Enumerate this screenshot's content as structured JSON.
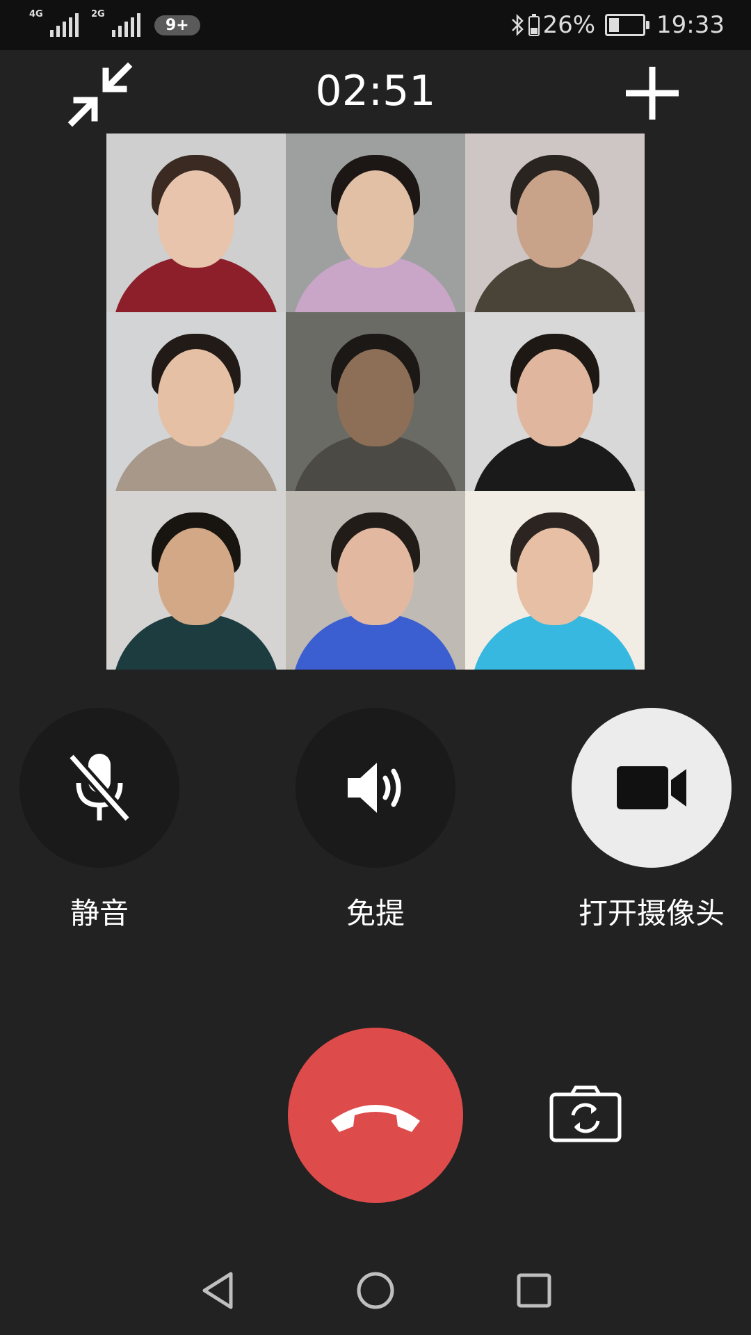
{
  "status_bar": {
    "signal1_label": "4G",
    "signal2_label": "2G",
    "notification_badge": "9+",
    "battery_percent": "26%",
    "time": "19:33"
  },
  "call": {
    "timer": "02:51"
  },
  "controls": {
    "mute_label": "静音",
    "speaker_label": "免提",
    "camera_label": "打开摄像头"
  },
  "icons": {
    "minimize": "minimize-icon",
    "add": "plus-icon",
    "mute": "mic-off-icon",
    "speaker": "speaker-icon",
    "camera": "video-camera-icon",
    "hangup": "phone-hangup-icon",
    "flip": "camera-flip-icon",
    "back": "back-triangle-icon",
    "home": "home-circle-icon",
    "recents": "recents-square-icon"
  },
  "colors": {
    "background": "#222222",
    "status_bar": "#101010",
    "hangup": "#de4b4b",
    "control_dark": "#1a1a1a",
    "control_light": "#ececec"
  },
  "participants": [
    {
      "bg": "#cfcfcf",
      "skin": "#e8c4ac",
      "hair": "#3a2a22",
      "shirt": "#8c1f2a"
    },
    {
      "bg": "#9ea0a0",
      "skin": "#e2c0a6",
      "hair": "#1c1714",
      "shirt": "#c9a5c8"
    },
    {
      "bg": "#cdc6c4",
      "skin": "#c9a28a",
      "hair": "#2a2420",
      "shirt": "#4a4438"
    },
    {
      "bg": "#d2d4d6",
      "skin": "#e5c0a4",
      "hair": "#221a16",
      "shirt": "#a7988a"
    },
    {
      "bg": "#6b6b66",
      "skin": "#8d6f58",
      "hair": "#1b1816",
      "shirt": "#4c4a44"
    },
    {
      "bg": "#d8d8d8",
      "skin": "#e0b79e",
      "hair": "#1e1814",
      "shirt": "#1a1a1a"
    },
    {
      "bg": "#d6d4d2",
      "skin": "#d3a886",
      "hair": "#18140f",
      "shirt": "#1c3c40"
    },
    {
      "bg": "#bfbab4",
      "skin": "#e2b9a0",
      "hair": "#221c18",
      "shirt": "#3b5ed0"
    },
    {
      "bg": "#f2ede4",
      "skin": "#e6bfa4",
      "hair": "#2b2420",
      "shirt": "#36b8e0"
    }
  ]
}
